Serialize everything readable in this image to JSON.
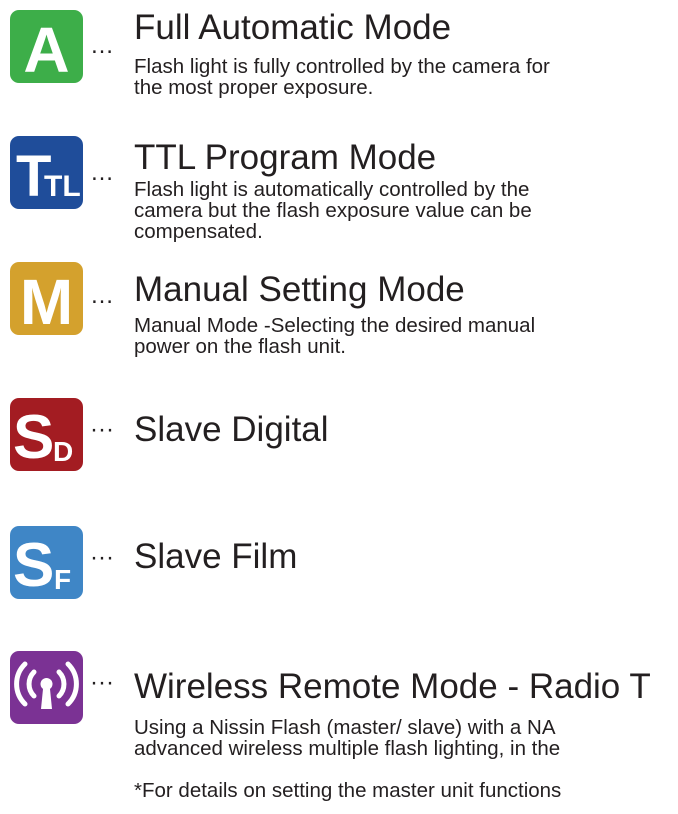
{
  "colors": {
    "auto": "#3dae49",
    "ttl": "#1f4d9a",
    "manual": "#d4a12d",
    "slave_digital": "#a31c22",
    "slave_film": "#3f86c6",
    "wireless": "#7b3294"
  },
  "modes": [
    {
      "icon": "auto-mode-icon",
      "icon_text": "A",
      "dots": "…",
      "title": "Full Automatic Mode",
      "desc": [
        "Flash light is fully controlled by the camera for",
        "the most proper exposure."
      ]
    },
    {
      "icon": "ttl-mode-icon",
      "icon_text": "TTL",
      "dots": "…",
      "title": "TTL Program Mode",
      "desc": [
        "Flash light is automatically controlled by the",
        "camera but the flash exposure value can be",
        "compensated."
      ]
    },
    {
      "icon": "manual-mode-icon",
      "icon_text": "M",
      "dots": "…",
      "title": "Manual Setting Mode",
      "desc": [
        "Manual Mode -Selecting the desired manual",
        "power on the flash unit."
      ]
    },
    {
      "icon": "slave-digital-icon",
      "icon_text": "SD",
      "dots": "···",
      "title": "Slave Digital"
    },
    {
      "icon": "slave-film-icon",
      "icon_text": "SF",
      "dots": "···",
      "title": "Slave Film"
    },
    {
      "icon": "wireless-radio-icon",
      "dots": "···",
      "title": "Wireless Remote Mode - Radio T",
      "desc": [
        "Using a Nissin Flash (master/ slave) with a NA",
        "advanced wireless multiple flash lighting, in the",
        "",
        "*For details on setting the master unit functions"
      ]
    }
  ]
}
